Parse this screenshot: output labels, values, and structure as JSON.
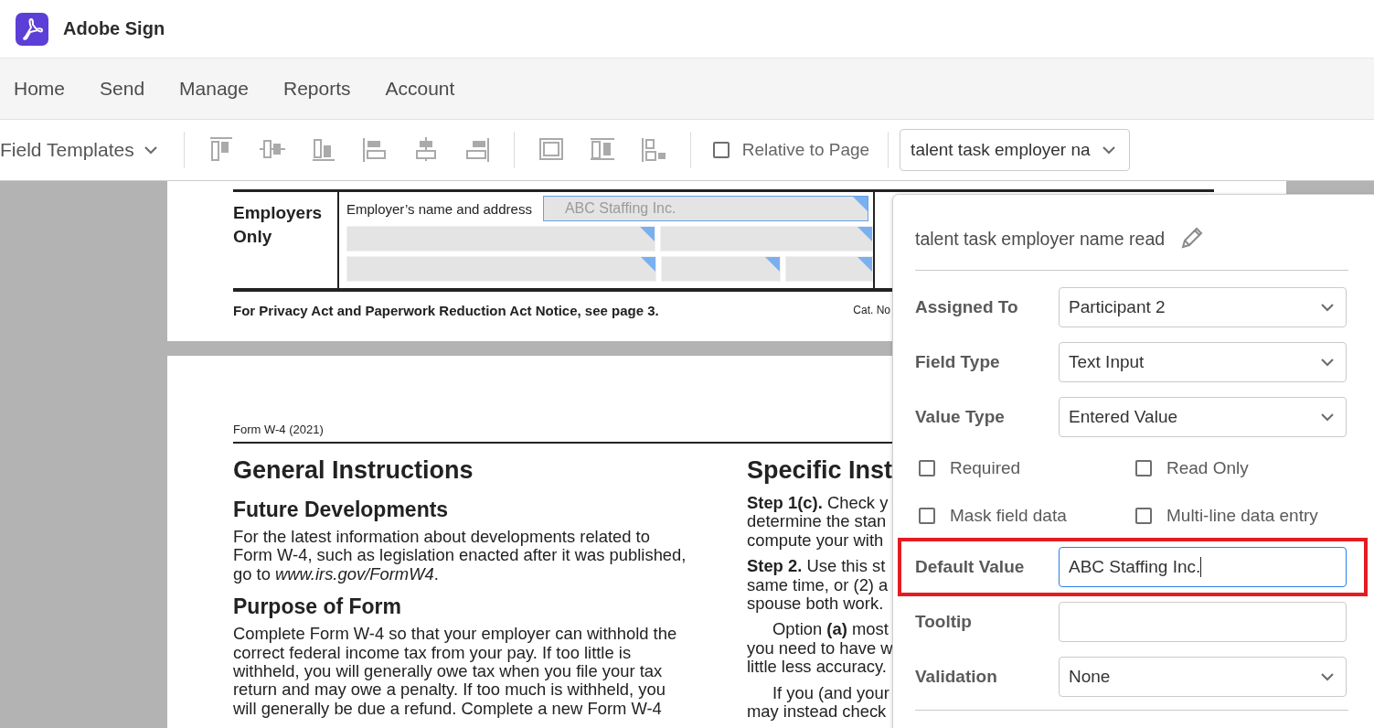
{
  "app": {
    "name": "Adobe Sign"
  },
  "nav": [
    {
      "label": "Home"
    },
    {
      "label": "Send"
    },
    {
      "label": "Manage"
    },
    {
      "label": "Reports"
    },
    {
      "label": "Account"
    }
  ],
  "toolbar": {
    "templates": "Field Templates",
    "tool_groups": [
      [
        {
          "kind": "align-top"
        },
        {
          "kind": "align-middle"
        },
        {
          "kind": "align-bottom"
        },
        {
          "kind": "align-left"
        },
        {
          "kind": "align-center"
        },
        {
          "kind": "align-right"
        }
      ],
      [
        {
          "kind": "same-height"
        },
        {
          "kind": "same-width"
        },
        {
          "kind": "same-size"
        }
      ]
    ],
    "relative_to_page": {
      "label": "Relative to Page",
      "checked": false
    },
    "field_select": "talent task employer na"
  },
  "document": {
    "page_1": {
      "section_label": "Employers Only",
      "field_label": "Employer’s name and address",
      "field_rows": [
        [
          {
            "value": "ABC Staffing Inc.",
            "selected": true
          }
        ],
        [
          {
            "selected": false
          },
          {
            "selected": false
          }
        ],
        [
          {
            "selected": false
          },
          {
            "selected": false
          },
          {
            "selected": false
          }
        ]
      ],
      "footer": "For Privacy Act and Paperwork Reduction Act Notice, see page 3.",
      "footer_right": "Cat. No"
    },
    "page_2": {
      "header": "Form W-4 (2021)",
      "left": [
        {
          "kind": "title",
          "text": "General Instructions"
        },
        {
          "kind": "heading",
          "text": "Future Developments"
        },
        {
          "kind": "para",
          "lines": [
            "For the latest information about developments related to",
            "Form W-4, such as legislation enacted after it was published,",
            "go to *www.irs.gov/FormW4*."
          ]
        },
        {
          "kind": "heading",
          "text": "Purpose of Form"
        },
        {
          "kind": "para",
          "lines": [
            "Complete Form W-4 so that your employer can withhold the",
            "correct federal income tax from your pay. If too little is",
            "withheld, you will generally owe tax when you file your tax",
            "return and may owe a penalty. If too much is withheld, you",
            "will generally be due a refund. Complete a new Form W-4"
          ]
        }
      ],
      "right": [
        {
          "kind": "title",
          "text": "Specific Inst"
        },
        {
          "kind": "para",
          "lines": [
            "**Step 1(c).** Check y",
            "determine the stan",
            "compute your with"
          ]
        },
        {
          "kind": "para",
          "lines": [
            "**Step 2.** Use this st",
            "same time, or (2) a",
            "spouse both work."
          ]
        },
        {
          "kind": "indent",
          "lines": [
            "Option **(a)** most",
            "you need to have w",
            "little less accuracy."
          ]
        },
        {
          "kind": "indent",
          "lines": [
            "If you (and your",
            "may instead check"
          ]
        }
      ]
    }
  },
  "panel": {
    "title": "talent task employer name read",
    "rows_top": [
      {
        "label": "Assigned To",
        "kind": "select",
        "value": "Participant 2"
      },
      {
        "label": "Field Type",
        "kind": "select",
        "value": "Text Input"
      },
      {
        "label": "Value Type",
        "kind": "select",
        "value": "Entered Value"
      }
    ],
    "checkboxes": [
      {
        "label": "Required",
        "checked": false
      },
      {
        "label": "Read Only",
        "checked": false
      },
      {
        "label": "Mask field data",
        "checked": false
      },
      {
        "label": "Multi-line data entry",
        "checked": false
      }
    ],
    "rows_bottom": [
      {
        "label": "Default Value",
        "kind": "input",
        "value": "ABC Staffing Inc.",
        "highlighted": true
      },
      {
        "label": "Tooltip",
        "kind": "input",
        "highlighted": false
      },
      {
        "label": "Validation",
        "kind": "select",
        "value": "None",
        "highlighted": false
      }
    ]
  }
}
